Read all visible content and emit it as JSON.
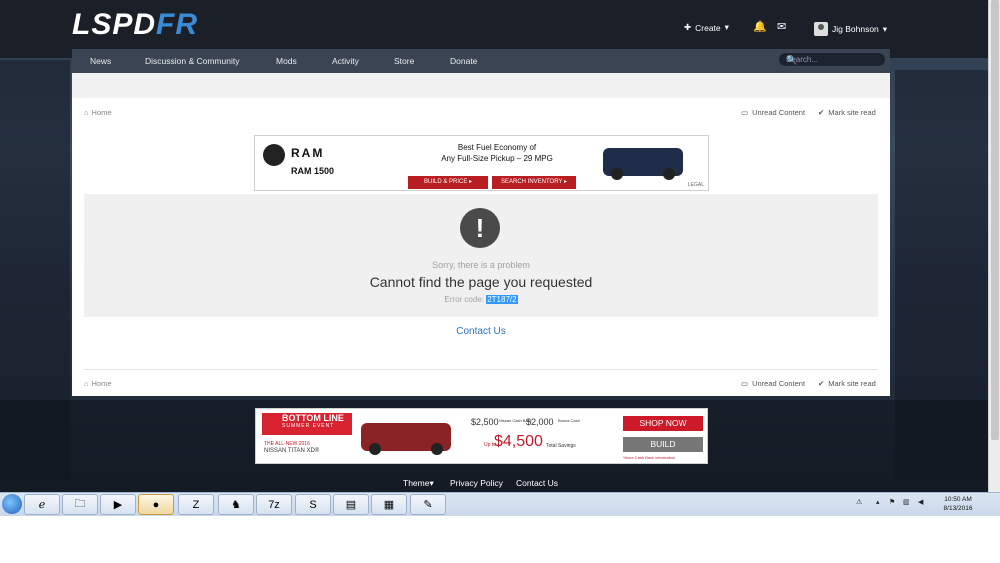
{
  "site": {
    "logo_white": "LSPD",
    "logo_blue": "FR"
  },
  "topbar": {
    "create": "Create",
    "user": "Jig Bohnson"
  },
  "nav": [
    "News",
    "Discussion & Community",
    "Mods",
    "Activity",
    "Store",
    "Donate"
  ],
  "search": {
    "placeholder": "Search..."
  },
  "breadcrumb": {
    "home": "Home",
    "unread": "Unread Content",
    "mark_read": "Mark site read"
  },
  "ad_top": {
    "brand": "RAM",
    "model": "RAM 1500",
    "headline_1": "Best Fuel Economy of",
    "headline_2": "Any Full-Size Pickup – 29 MPG",
    "btn_build": "BUILD & PRICE ▸",
    "btn_search": "SEARCH INVENTORY ▸",
    "legal": "LEGAL"
  },
  "error": {
    "sub": "Sorry, there is a problem",
    "title": "Cannot find the page you requested",
    "code_label": "Error code:",
    "code": "2T187/2"
  },
  "contact": "Contact Us",
  "ad_bottom": {
    "headline": "BOTTOM LINE",
    "sub": "SUMMER EVENT",
    "model_1": "THE ALL-NEW 2016",
    "model_2": "NISSAN TITAN XD®",
    "offer_1": "$2,500",
    "offer_1_note": "Nissan Cash Back",
    "offer_2": "$2,000",
    "offer_2_note": "Bonus Cash",
    "upto": "Up to",
    "total": "$4,500",
    "total_note": "Total Savings",
    "shop": "SHOP NOW",
    "build": "BUILD",
    "disclaimer": "*More Cash Back information"
  },
  "footer": {
    "theme": "Theme",
    "privacy": "Privacy Policy",
    "contact": "Contact Us"
  },
  "taskbar": {
    "time": "10:50 AM",
    "date": "8/13/2016"
  },
  "colors": {
    "accent": "#3b8cd6",
    "nav_bg": "#3b4452",
    "topbar_bg": "#1b2028",
    "link": "#2b71c2"
  }
}
